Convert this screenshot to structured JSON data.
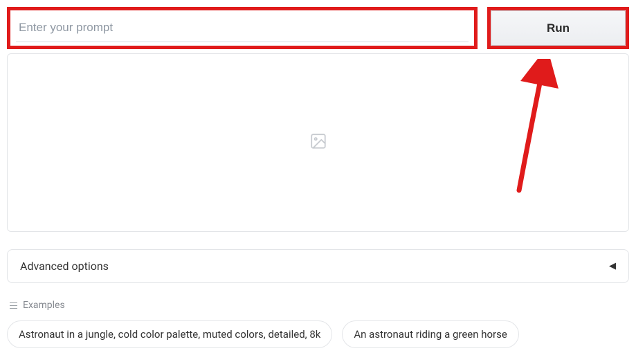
{
  "prompt": {
    "placeholder": "Enter your prompt",
    "value": ""
  },
  "run_button_label": "Run",
  "advanced_label": "Advanced options",
  "examples_header": "Examples",
  "examples": [
    "Astronaut in a jungle, cold color palette, muted colors, detailed, 8k",
    "An astronaut riding a green horse"
  ],
  "annotation_color": "#e01b1b"
}
